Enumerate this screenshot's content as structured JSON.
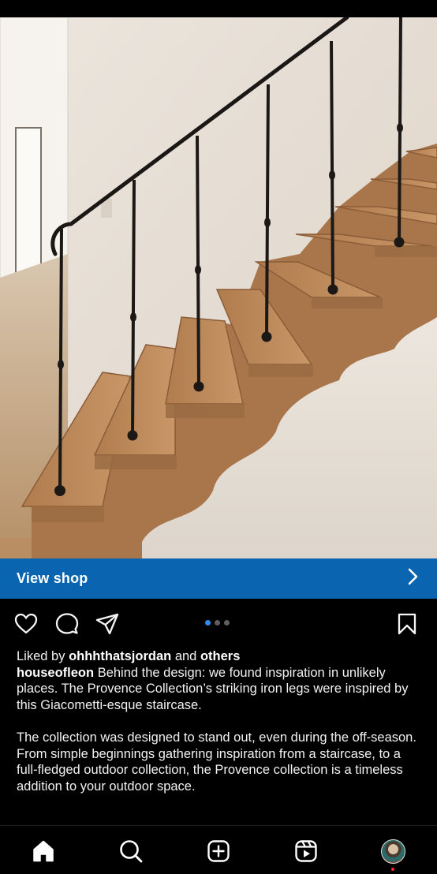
{
  "post": {
    "shop_button_label": "View shop",
    "carousel": {
      "count": 3,
      "active_index": 0
    },
    "likes": {
      "prefix": "Liked by",
      "user": "ohhhthatsjordan",
      "connector": "and",
      "others": "others"
    },
    "caption": {
      "username": "houseofleon",
      "text_1": "Behind the design: we found inspiration in unlikely places. The Provence Collection’s striking iron legs were inspired by this Giacometti-esque staircase.",
      "text_2": "The collection was designed to stand out, even during the off-season. From simple beginnings gathering inspiration from a staircase, to a full-fledged outdoor collection, the Provence collection is a timeless addition to your outdoor space."
    }
  },
  "icons": {
    "like": "heart-icon",
    "comment": "comment-icon",
    "share": "send-icon",
    "save": "bookmark-icon",
    "shop_arrow": "chevron-right-icon"
  },
  "bottom_nav": [
    "home-icon",
    "search-icon",
    "create-icon",
    "reels-icon",
    "profile-avatar"
  ],
  "colors": {
    "shop_bar": "#0a64b0",
    "active_dot": "#2d8cf0",
    "background": "#000000",
    "notification_dot": "#ff2d2d"
  }
}
